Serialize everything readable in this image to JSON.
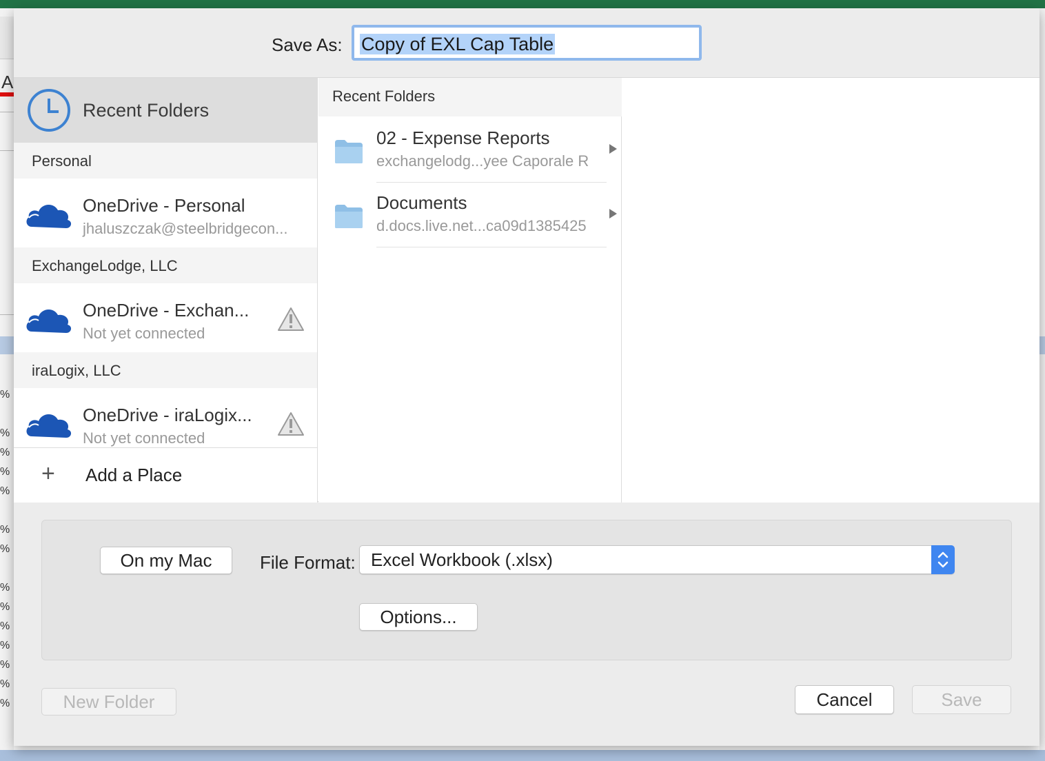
{
  "save_as": {
    "label": "Save As:",
    "value": "Copy of EXL Cap Table"
  },
  "sidebar": {
    "title": "Recent Folders",
    "groups": [
      {
        "header": "Personal",
        "item": {
          "name": "OneDrive - Personal",
          "sub": "jhaluszczak@steelbridgecon...",
          "warning": false
        }
      },
      {
        "header": "ExchangeLodge, LLC",
        "item": {
          "name": "OneDrive - Exchan...",
          "sub": "Not yet connected",
          "warning": true
        }
      },
      {
        "header": "iraLogix, LLC",
        "item": {
          "name": "OneDrive - iraLogix...",
          "sub": "Not yet connected",
          "warning": true
        }
      }
    ],
    "add_place": "Add a Place"
  },
  "folders": {
    "header": "Recent Folders",
    "items": [
      {
        "name": "02 - Expense Reports",
        "path": "exchangelodg...yee  Caporale R"
      },
      {
        "name": "Documents",
        "path": "d.docs.live.net...ca09d1385425"
      }
    ]
  },
  "options": {
    "on_my_mac": "On my Mac",
    "file_format_label": "File Format:",
    "file_format_value": "Excel Workbook (.xlsx)",
    "options_button": "Options..."
  },
  "footer": {
    "new_folder": "New Folder",
    "cancel": "Cancel",
    "save": "Save"
  },
  "background": {
    "cell_letter": "A",
    "percent_sign": "%"
  },
  "colors": {
    "accent": "#3f86f0",
    "excel_green": "#217346",
    "selection": "#b3d3f9",
    "cloud_blue": "#1c56b5"
  }
}
